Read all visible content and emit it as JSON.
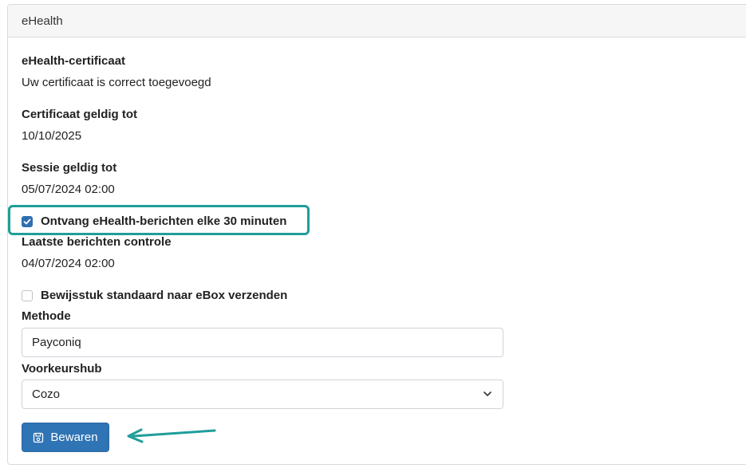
{
  "card": {
    "title": "eHealth"
  },
  "certificate": {
    "label": "eHealth-certificaat",
    "value": "Uw certificaat is correct toegevoegd"
  },
  "certificate_valid": {
    "label": "Certificaat geldig tot",
    "value": "10/10/2025"
  },
  "session_valid": {
    "label": "Sessie geldig tot",
    "value": "05/07/2024 02:00"
  },
  "receive_messages": {
    "label": "Ontvang eHealth-berichten elke 30 minuten",
    "checked": true
  },
  "last_check": {
    "label": "Laatste berichten controle",
    "value": "04/07/2024 02:00"
  },
  "send_proof": {
    "label": "Bewijsstuk standaard naar eBox verzenden",
    "checked": false
  },
  "method": {
    "label": "Methode",
    "value": "Payconiq"
  },
  "preferred_hub": {
    "label": "Voorkeurshub",
    "value": "Cozo"
  },
  "save_button": {
    "label": "Bewaren"
  },
  "colors": {
    "primary": "#2f74b5",
    "highlight": "#1f9e9a"
  }
}
